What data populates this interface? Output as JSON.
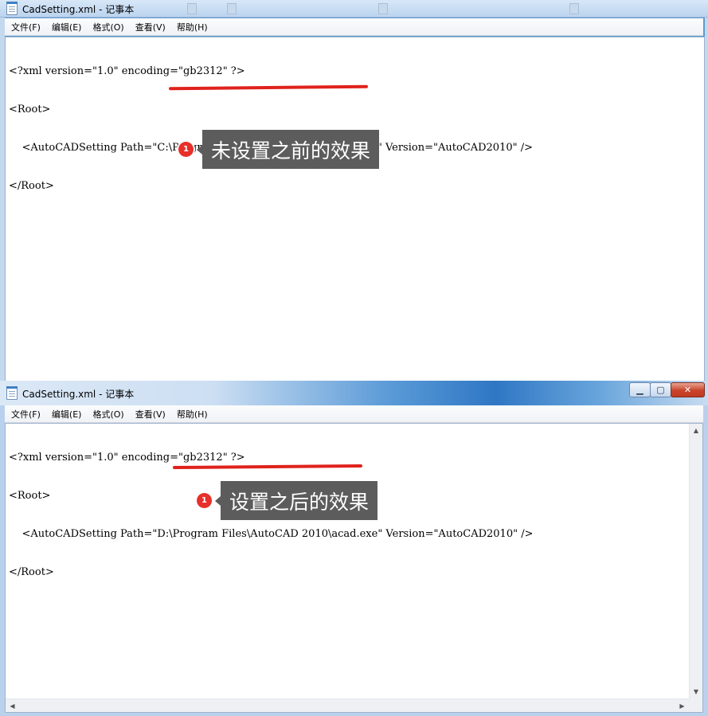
{
  "windows": [
    {
      "title": "CadSetting.xml - 记事本",
      "menu": [
        "文件(F)",
        "编辑(E)",
        "格式(O)",
        "查看(V)",
        "帮助(H)"
      ],
      "lines": [
        "<?xml version=\"1.0\" encoding=\"gb2312\" ?>",
        "<Root>",
        "    <AutoCADSetting Path=\"C:\\Program Files\\AutoCAD 2010\\acad.exe\" Version=\"AutoCAD2010\" />",
        "</Root>"
      ],
      "callout": {
        "number": "1",
        "text": "未设置之前的效果"
      }
    },
    {
      "title": "CadSetting.xml - 记事本",
      "menu": [
        "文件(F)",
        "编辑(E)",
        "格式(O)",
        "查看(V)",
        "帮助(H)"
      ],
      "lines": [
        "<?xml version=\"1.0\" encoding=\"gb2312\" ?>",
        "<Root>",
        "    <AutoCADSetting Path=\"D:\\Program Files\\AutoCAD 2010\\acad.exe\" Version=\"AutoCAD2010\" />",
        "</Root>"
      ],
      "callout": {
        "number": "1",
        "text": "设置之后的效果"
      }
    }
  ],
  "controls": {
    "minimize": "▁",
    "maximize": "▢",
    "close": "✕"
  },
  "scroll_arrows": {
    "up": "▲",
    "down": "▼",
    "left": "◀",
    "right": "▶"
  },
  "colors": {
    "underline": "#e0221c",
    "badge": "#e8302a",
    "bubble": "#5c5c5c"
  }
}
